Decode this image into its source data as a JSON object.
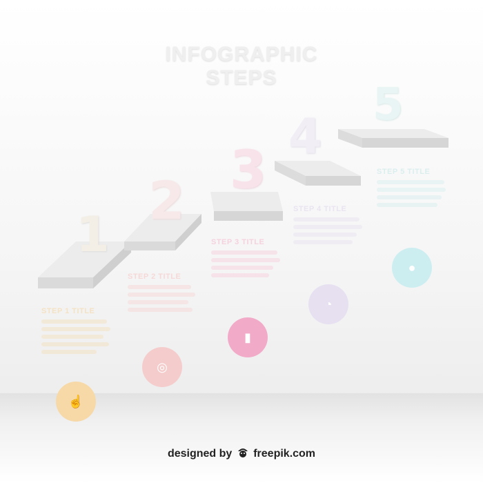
{
  "title": "INFOGRAPHIC STEPS",
  "steps": [
    {
      "number": "1",
      "title": "STEP 1 TITLE",
      "color": "#f6d9a6",
      "icon": "finger-tap-icon",
      "glyph": "☝"
    },
    {
      "number": "2",
      "title": "STEP 2 TITLE",
      "color": "#f5c6c6",
      "icon": "target-icon",
      "glyph": "◎"
    },
    {
      "number": "3",
      "title": "STEP 3 TITLE",
      "color": "#f0a8c6",
      "icon": "bar-chart-icon",
      "glyph": "▮"
    },
    {
      "number": "4",
      "title": "STEP 4 TITLE",
      "color": "#e4def0",
      "icon": "clock-icon",
      "glyph": "◔"
    },
    {
      "number": "5",
      "title": "STEP 5 TITLE",
      "color": "#c7ecf0",
      "icon": "user-icon",
      "glyph": "●"
    }
  ],
  "credit": {
    "prefix": "designed by",
    "brand": "freepik.com",
    "logo_icon": "freepik-logo-icon"
  }
}
